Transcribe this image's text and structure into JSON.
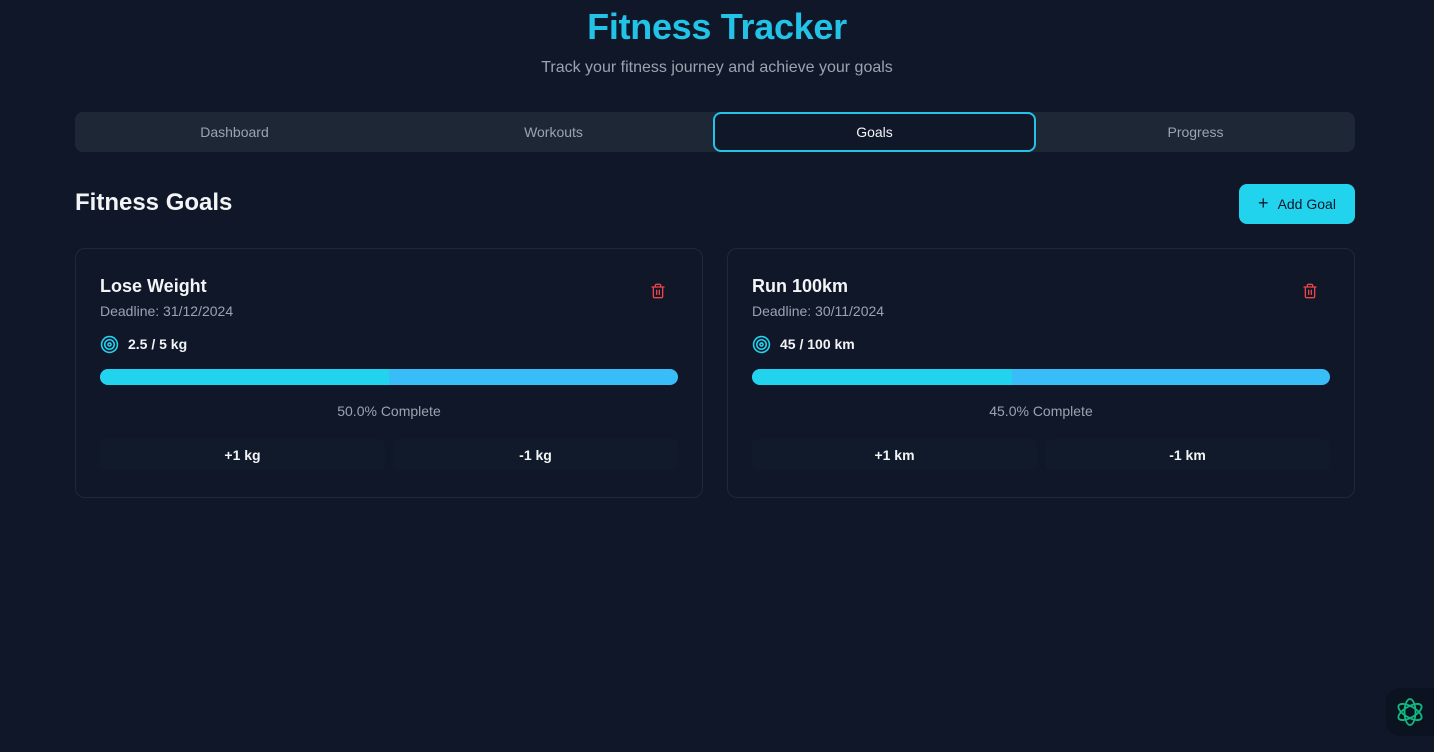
{
  "header": {
    "title": "Fitness Tracker",
    "subtitle": "Track your fitness journey and achieve your goals"
  },
  "tabs": [
    {
      "label": "Dashboard",
      "active": false
    },
    {
      "label": "Workouts",
      "active": false
    },
    {
      "label": "Goals",
      "active": true
    },
    {
      "label": "Progress",
      "active": false
    }
  ],
  "goals_section": {
    "title": "Fitness Goals",
    "add_button_label": "Add Goal",
    "add_button_icon": "plus-icon"
  },
  "goals": [
    {
      "title": "Lose Weight",
      "deadline": "Deadline: 31/12/2024",
      "progress_text": "2.5 / 5 kg",
      "progress_fraction": 0.5,
      "complete_text": "50.0% Complete",
      "increment_label": "+1 kg",
      "decrement_label": "-1 kg"
    },
    {
      "title": "Run 100km",
      "deadline": "Deadline: 30/11/2024",
      "progress_text": "45 / 100 km",
      "progress_fraction": 0.45,
      "complete_text": "45.0% Complete",
      "increment_label": "+1 km",
      "decrement_label": "-1 km"
    }
  ],
  "icons": {
    "delete": "trash-icon",
    "target": "target-icon",
    "assistant": "openai-logo-icon"
  },
  "colors": {
    "background": "#0f1729",
    "accent": "#22d3ee",
    "bar_track": "#38bdf8",
    "delete": "#ef4444"
  }
}
